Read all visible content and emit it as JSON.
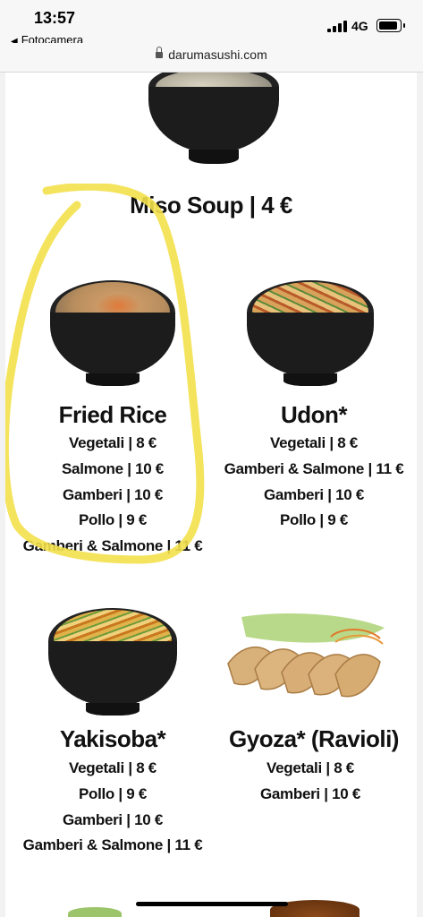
{
  "status": {
    "time": "13:57",
    "back_label": "Fotocamera",
    "network": "4G"
  },
  "browser": {
    "url": "darumasushi.com"
  },
  "menu": {
    "miso": {
      "title": "Miso Soup | 4 €"
    },
    "fried_rice": {
      "title": "Fried Rice",
      "lines": [
        "Vegetali | 8 €",
        "Salmone | 10 €",
        "Gamberi | 10 €",
        "Pollo | 9 €",
        "Gamberi & Salmone | 11 €"
      ]
    },
    "udon": {
      "title": "Udon*",
      "lines": [
        "Vegetali | 8 €",
        "Gamberi & Salmone | 11 €",
        "Gamberi | 10 €",
        "Pollo | 9 €"
      ]
    },
    "yakisoba": {
      "title": "Yakisoba*",
      "lines": [
        "Vegetali | 8 €",
        "Pollo | 9 €",
        "Gamberi | 10 €",
        "Gamberi & Salmone | 11 €"
      ]
    },
    "gyoza": {
      "title": "Gyoza* (Ravioli)",
      "lines": [
        "Vegetali | 8 €",
        "Gamberi | 10 €"
      ]
    }
  },
  "colors": {
    "highlight": "#f3e04a",
    "bowl": "#1c1c1c"
  }
}
